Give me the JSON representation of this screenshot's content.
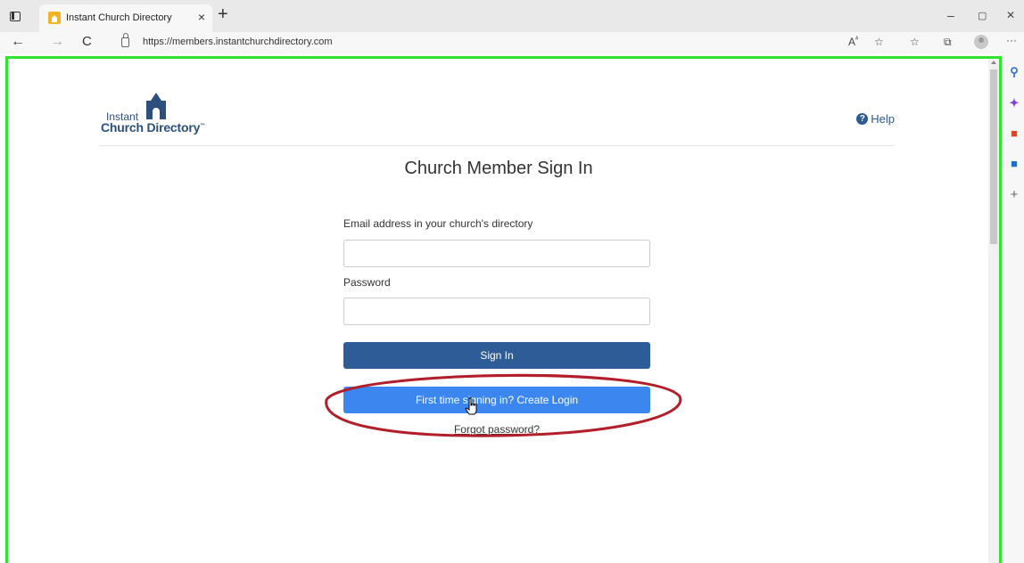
{
  "browser": {
    "tab_title": "Instant Church Directory",
    "tab_close": "×",
    "new_tab": "+",
    "url": "https://members.instantchurchdirectory.com",
    "window_controls": {
      "minimize": "–",
      "restore": "▢",
      "close": "✕"
    },
    "nav": {
      "back": "←",
      "forward": "→",
      "reload": "C"
    },
    "toolbar_icons": [
      "read-aloud-icon",
      "favorite-add-icon",
      "favorites-icon",
      "collections-icon",
      "profile-icon",
      "more-icon"
    ],
    "more_label": "···"
  },
  "sidebar": {
    "icons": [
      "search-icon",
      "copilot-icon",
      "office-icon",
      "outlook-icon",
      "add-icon"
    ],
    "add_label": "+"
  },
  "header": {
    "logo_line1": "Instant",
    "logo_line2": "Church Directory",
    "logo_tm": "™",
    "help_icon_glyph": "?",
    "help_label": "Help"
  },
  "page": {
    "title": "Church Member Sign In"
  },
  "form": {
    "email_label": "Email address in your church's directory",
    "email_value": "",
    "password_label": "Password",
    "password_value": "",
    "signin_label": "Sign In",
    "create_login_label": "First time signing in? Create Login",
    "forgot_label": "Forgot password?"
  },
  "colors": {
    "brand": "#2c4f7c",
    "signin_button": "#2e5c96",
    "create_login_button": "#3c86ef",
    "annotation_ellipse": "#b21f2a",
    "viewport_highlight": "#2ee62e"
  }
}
